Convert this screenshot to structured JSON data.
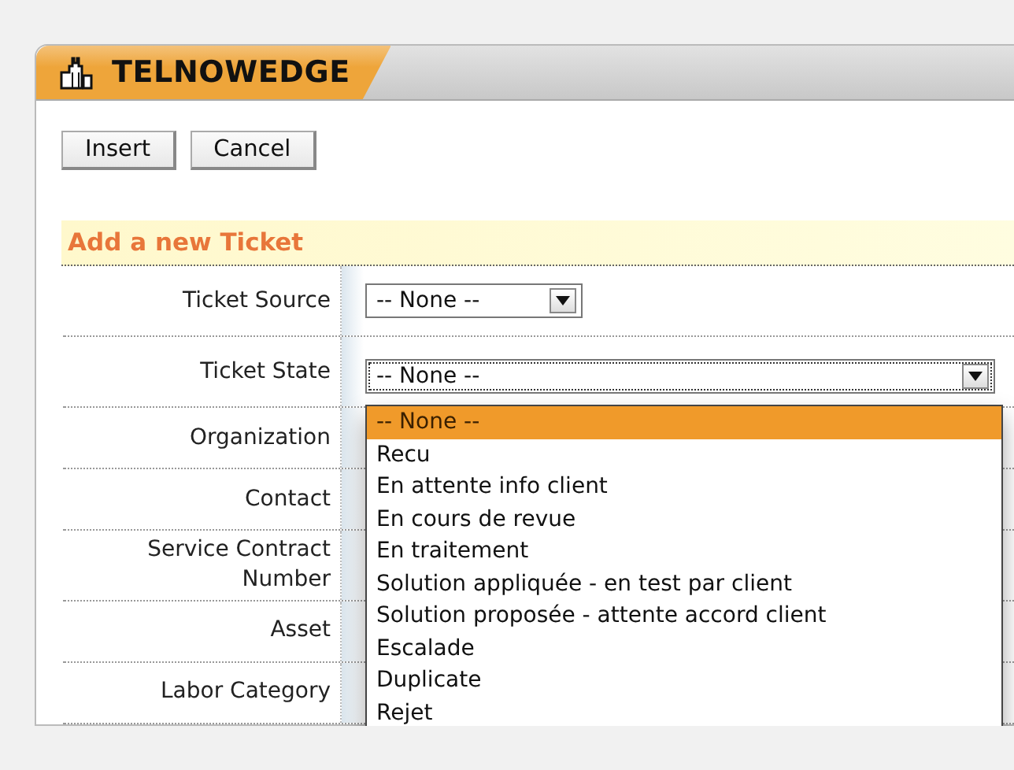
{
  "app": {
    "title": "TELNOWEDGE"
  },
  "buttons": [
    "Insert",
    "Cancel"
  ],
  "section": {
    "title": "Add a new Ticket"
  },
  "fields": [
    {
      "label": "Ticket Source",
      "kind": "select",
      "value": "-- None --",
      "wide": false,
      "focused": false
    },
    {
      "label": "Ticket State",
      "kind": "select",
      "value": "-- None --",
      "wide": true,
      "focused": true
    },
    {
      "label": "Organization",
      "kind": "hidden"
    },
    {
      "label": "Contact",
      "kind": "hidden"
    },
    {
      "label": "Service Contract Number",
      "kind": "hidden"
    },
    {
      "label": "Asset",
      "kind": "hidden"
    },
    {
      "label": "Labor Category",
      "kind": "hidden"
    }
  ],
  "dropdown": {
    "options": [
      {
        "label": "-- None --",
        "selected": true
      },
      {
        "label": "Recu",
        "selected": false
      },
      {
        "label": "En attente info client",
        "selected": false
      },
      {
        "label": "En cours de revue",
        "selected": false
      },
      {
        "label": "En traitement",
        "selected": false
      },
      {
        "label": "Solution appliquée - en test par client",
        "selected": false
      },
      {
        "label": "Solution proposée - attente accord client",
        "selected": false
      },
      {
        "label": "Escalade",
        "selected": false
      },
      {
        "label": "Duplicate",
        "selected": false
      },
      {
        "label": "Rejet",
        "selected": false
      }
    ]
  }
}
